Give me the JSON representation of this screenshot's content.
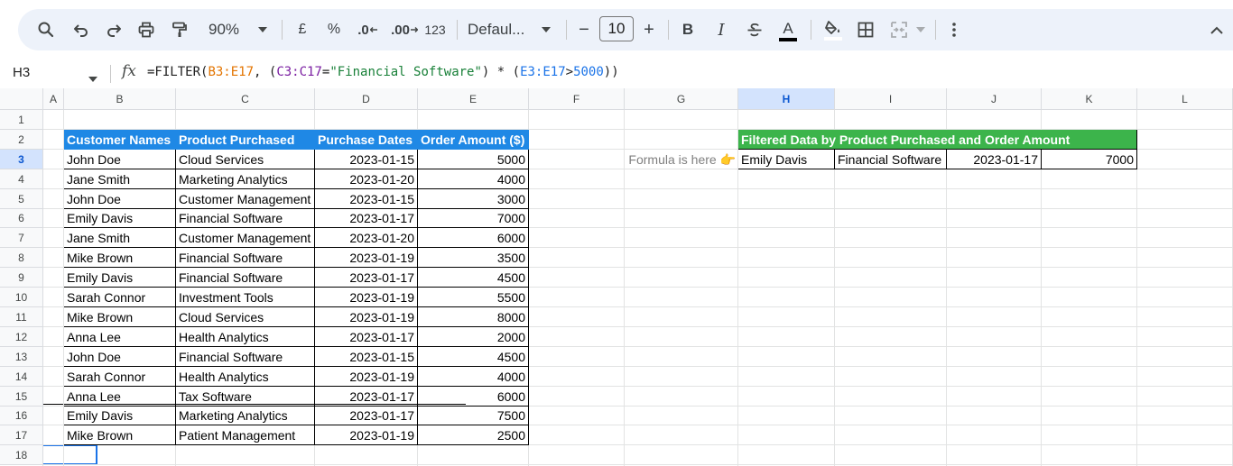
{
  "toolbar": {
    "zoom": "90%",
    "currency": "£",
    "percent": "%",
    "decrease_decimals": ".0",
    "increase_decimals": ".00",
    "number_format": "123",
    "font_name": "Defaul...",
    "font_size": "10",
    "bold": "B",
    "italic": "I",
    "text_color_letter": "A",
    "minus": "−",
    "plus": "+"
  },
  "formula_bar": {
    "cell_ref": "H3",
    "fx": "fx",
    "formula_parts": {
      "p1": "=FILTER(",
      "p2": "B3:E17",
      "p3": ", (",
      "p4": "C3:C17",
      "p5": "=",
      "p6": "\"Financial Software\"",
      "p7": ") * (",
      "p8": "E3:E17",
      "p9": ">",
      "p10": "5000",
      "p11": "))"
    }
  },
  "grid": {
    "columns": [
      "A",
      "B",
      "C",
      "D",
      "E",
      "F",
      "G",
      "H",
      "I",
      "J",
      "K",
      "L"
    ],
    "rows": [
      "1",
      "2",
      "3",
      "4",
      "5",
      "6",
      "7",
      "8",
      "9",
      "10",
      "11",
      "12",
      "13",
      "14",
      "15",
      "16",
      "17",
      "18"
    ],
    "selected_column": "H",
    "selected_row": "3"
  },
  "table": {
    "headers": [
      "Customer Names",
      "Product Purchased",
      "Purchase Dates",
      "Order Amount ($)"
    ],
    "rows": [
      [
        "John Doe",
        "Cloud Services",
        "2023-01-15",
        "5000"
      ],
      [
        "Jane Smith",
        "Marketing Analytics",
        "2023-01-20",
        "4000"
      ],
      [
        "John Doe",
        "Customer Management",
        "2023-01-15",
        "3000"
      ],
      [
        "Emily Davis",
        "Financial Software",
        "2023-01-17",
        "7000"
      ],
      [
        "Jane Smith",
        "Customer Management",
        "2023-01-20",
        "6000"
      ],
      [
        "Mike Brown",
        "Financial Software",
        "2023-01-19",
        "3500"
      ],
      [
        "Emily Davis",
        "Financial Software",
        "2023-01-17",
        "4500"
      ],
      [
        "Sarah Connor",
        "Investment Tools",
        "2023-01-19",
        "5500"
      ],
      [
        "Mike Brown",
        "Cloud Services",
        "2023-01-19",
        "8000"
      ],
      [
        "Anna Lee",
        "Health Analytics",
        "2023-01-17",
        "2000"
      ],
      [
        "John Doe",
        "Financial Software",
        "2023-01-15",
        "4500"
      ],
      [
        "Sarah Connor",
        "Health Analytics",
        "2023-01-19",
        "4000"
      ],
      [
        "Anna Lee",
        "Tax Software",
        "2023-01-17",
        "6000"
      ],
      [
        "Emily Davis",
        "Marketing Analytics",
        "2023-01-17",
        "7500"
      ],
      [
        "Mike Brown",
        "Patient Management",
        "2023-01-19",
        "2500"
      ]
    ]
  },
  "filtered": {
    "title": "Filtered Data by Product Purchased and Order Amount",
    "note": "Formula is here 👉",
    "row": [
      "Emily Davis",
      "Financial Software",
      "2023-01-17",
      "7000"
    ]
  },
  "colors": {
    "header_blue": "#1f88e5",
    "header_green": "#3cb44b",
    "selection": "#1a73e8"
  }
}
